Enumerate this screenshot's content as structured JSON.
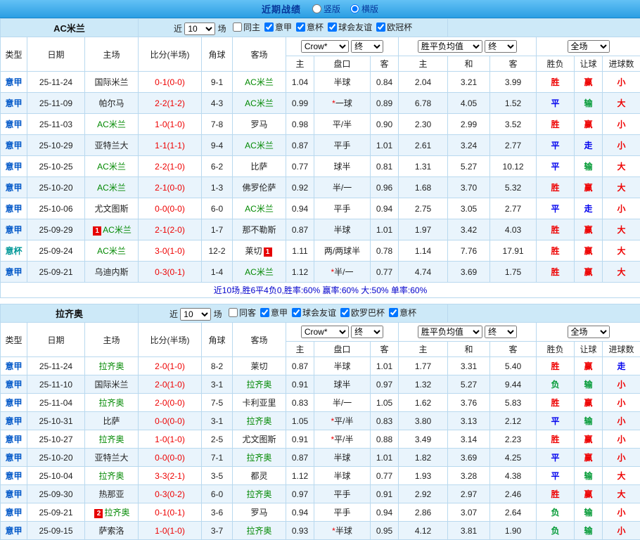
{
  "topbar": {
    "title": "近期战绩",
    "options": [
      {
        "label": "竖版",
        "selected": false
      },
      {
        "label": "横版",
        "selected": true
      }
    ]
  },
  "table_header": {
    "col_type": "类型",
    "col_date": "日期",
    "col_home": "主场",
    "col_score": "比分(半场)",
    "col_corner": "角球",
    "col_away": "客场",
    "col_h": "主",
    "col_handicap": "盘口",
    "col_a": "客",
    "col_ew": "主",
    "col_ed": "和",
    "col_el": "客",
    "col_win": "胜负",
    "col_let": "让球",
    "col_goal": "进球数"
  },
  "colors": {
    "type": {
      "意甲": "#0057c8",
      "意杯": "#009898"
    },
    "outcome": {
      "胜": "#ee0000",
      "平": "#0000ee",
      "负": "#009933",
      "赢": "#ee0000",
      "输": "#009933",
      "走": "#0000ee",
      "大": "#ee0000",
      "小": "#ee0000"
    },
    "team_highlight": "#008800",
    "score": "#ee0000",
    "asterisk": "#ee0000"
  },
  "sections": [
    {
      "team": "AC米兰",
      "near_label": "近",
      "count": "10",
      "matches_label": "场",
      "checkboxes": [
        {
          "label": "同主",
          "checked": false
        },
        {
          "label": "意甲",
          "checked": true
        },
        {
          "label": "意杯",
          "checked": true
        },
        {
          "label": "球会友谊",
          "checked": true
        },
        {
          "label": "欧冠杯",
          "checked": true
        }
      ],
      "dropdowns": [
        "Crow*",
        "终",
        "胜平负均值",
        "终",
        "全场"
      ],
      "rows": [
        {
          "type": "意甲",
          "date": "25-11-24",
          "home": "国际米兰",
          "home_badge": "",
          "score": "0-1(0-0)",
          "corner": "9-1",
          "away": "AC米兰",
          "away_badge": "",
          "odds": [
            "1.04",
            "半球",
            "0.84"
          ],
          "europe": [
            "2.04",
            "3.21",
            "3.99"
          ],
          "result": [
            "胜",
            "赢",
            "小"
          ]
        },
        {
          "type": "意甲",
          "date": "25-11-09",
          "home": "帕尔马",
          "home_badge": "",
          "score": "2-2(1-2)",
          "corner": "4-3",
          "away": "AC米兰",
          "away_badge": "",
          "odds": [
            "0.99",
            "*一球",
            "0.89"
          ],
          "europe": [
            "6.78",
            "4.05",
            "1.52"
          ],
          "result": [
            "平",
            "输",
            "大"
          ]
        },
        {
          "type": "意甲",
          "date": "25-11-03",
          "home": "AC米兰",
          "home_badge": "",
          "score": "1-0(1-0)",
          "corner": "7-8",
          "away": "罗马",
          "away_badge": "",
          "odds": [
            "0.98",
            "平/半",
            "0.90"
          ],
          "europe": [
            "2.30",
            "2.99",
            "3.52"
          ],
          "result": [
            "胜",
            "赢",
            "小"
          ]
        },
        {
          "type": "意甲",
          "date": "25-10-29",
          "home": "亚特兰大",
          "home_badge": "",
          "score": "1-1(1-1)",
          "corner": "9-4",
          "away": "AC米兰",
          "away_badge": "",
          "odds": [
            "0.87",
            "平手",
            "1.01"
          ],
          "europe": [
            "2.61",
            "3.24",
            "2.77"
          ],
          "result": [
            "平",
            "走",
            "小"
          ]
        },
        {
          "type": "意甲",
          "date": "25-10-25",
          "home": "AC米兰",
          "home_badge": "",
          "score": "2-2(1-0)",
          "corner": "6-2",
          "away": "比萨",
          "away_badge": "",
          "odds": [
            "0.77",
            "球半",
            "0.81"
          ],
          "europe": [
            "1.31",
            "5.27",
            "10.12"
          ],
          "result": [
            "平",
            "输",
            "大"
          ]
        },
        {
          "type": "意甲",
          "date": "25-10-20",
          "home": "AC米兰",
          "home_badge": "",
          "score": "2-1(0-0)",
          "corner": "1-3",
          "away": "佛罗伦萨",
          "away_badge": "",
          "odds": [
            "0.92",
            "半/一",
            "0.96"
          ],
          "europe": [
            "1.68",
            "3.70",
            "5.32"
          ],
          "result": [
            "胜",
            "赢",
            "大"
          ]
        },
        {
          "type": "意甲",
          "date": "25-10-06",
          "home": "尤文图斯",
          "home_badge": "",
          "score": "0-0(0-0)",
          "corner": "6-0",
          "away": "AC米兰",
          "away_badge": "",
          "odds": [
            "0.94",
            "平手",
            "0.94"
          ],
          "europe": [
            "2.75",
            "3.05",
            "2.77"
          ],
          "result": [
            "平",
            "走",
            "小"
          ]
        },
        {
          "type": "意甲",
          "date": "25-09-29",
          "home": "AC米兰",
          "home_badge": "1",
          "score": "2-1(2-0)",
          "corner": "1-7",
          "away": "那不勒斯",
          "away_badge": "",
          "odds": [
            "0.87",
            "半球",
            "1.01"
          ],
          "europe": [
            "1.97",
            "3.42",
            "4.03"
          ],
          "result": [
            "胜",
            "赢",
            "大"
          ]
        },
        {
          "type": "意杯",
          "date": "25-09-24",
          "home": "AC米兰",
          "home_badge": "",
          "score": "3-0(1-0)",
          "corner": "12-2",
          "away": "莱切",
          "away_badge": "1",
          "odds": [
            "1.11",
            "两/两球半",
            "0.78"
          ],
          "europe": [
            "1.14",
            "7.76",
            "17.91"
          ],
          "result": [
            "胜",
            "赢",
            "大"
          ]
        },
        {
          "type": "意甲",
          "date": "25-09-21",
          "home": "乌迪内斯",
          "home_badge": "",
          "score": "0-3(0-1)",
          "corner": "1-4",
          "away": "AC米兰",
          "away_badge": "",
          "odds": [
            "1.12",
            "*半/一",
            "0.77"
          ],
          "europe": [
            "4.74",
            "3.69",
            "1.75"
          ],
          "result": [
            "胜",
            "赢",
            "大"
          ]
        }
      ],
      "summary": "近10场,胜6平4负0,胜率:60% 赢率:60% 大:50% 单率:60%"
    },
    {
      "team": "拉齐奥",
      "near_label": "近",
      "count": "10",
      "matches_label": "场",
      "checkboxes": [
        {
          "label": "同客",
          "checked": false
        },
        {
          "label": "意甲",
          "checked": true
        },
        {
          "label": "球会友谊",
          "checked": true
        },
        {
          "label": "欧罗巴杯",
          "checked": true
        },
        {
          "label": "意杯",
          "checked": true
        }
      ],
      "dropdowns": [
        "Crow*",
        "终",
        "胜平负均值",
        "终",
        "全场"
      ],
      "rows": [
        {
          "type": "意甲",
          "date": "25-11-24",
          "home": "拉齐奥",
          "home_badge": "",
          "score": "2-0(1-0)",
          "corner": "8-2",
          "away": "莱切",
          "away_badge": "",
          "odds": [
            "0.87",
            "半球",
            "1.01"
          ],
          "europe": [
            "1.77",
            "3.31",
            "5.40"
          ],
          "result": [
            "胜",
            "赢",
            "走"
          ]
        },
        {
          "type": "意甲",
          "date": "25-11-10",
          "home": "国际米兰",
          "home_badge": "",
          "score": "2-0(1-0)",
          "corner": "3-1",
          "away": "拉齐奥",
          "away_badge": "",
          "odds": [
            "0.91",
            "球半",
            "0.97"
          ],
          "europe": [
            "1.32",
            "5.27",
            "9.44"
          ],
          "result": [
            "负",
            "输",
            "小"
          ]
        },
        {
          "type": "意甲",
          "date": "25-11-04",
          "home": "拉齐奥",
          "home_badge": "",
          "score": "2-0(0-0)",
          "corner": "7-5",
          "away": "卡利亚里",
          "away_badge": "",
          "odds": [
            "0.83",
            "半/一",
            "1.05"
          ],
          "europe": [
            "1.62",
            "3.76",
            "5.83"
          ],
          "result": [
            "胜",
            "赢",
            "小"
          ]
        },
        {
          "type": "意甲",
          "date": "25-10-31",
          "home": "比萨",
          "home_badge": "",
          "score": "0-0(0-0)",
          "corner": "3-1",
          "away": "拉齐奥",
          "away_badge": "",
          "odds": [
            "1.05",
            "*平/半",
            "0.83"
          ],
          "europe": [
            "3.80",
            "3.13",
            "2.12"
          ],
          "result": [
            "平",
            "输",
            "小"
          ]
        },
        {
          "type": "意甲",
          "date": "25-10-27",
          "home": "拉齐奥",
          "home_badge": "",
          "score": "1-0(1-0)",
          "corner": "2-5",
          "away": "尤文图斯",
          "away_badge": "",
          "odds": [
            "0.91",
            "*平/半",
            "0.88"
          ],
          "europe": [
            "3.49",
            "3.14",
            "2.23"
          ],
          "result": [
            "胜",
            "赢",
            "小"
          ]
        },
        {
          "type": "意甲",
          "date": "25-10-20",
          "home": "亚特兰大",
          "home_badge": "",
          "score": "0-0(0-0)",
          "corner": "7-1",
          "away": "拉齐奥",
          "away_badge": "",
          "odds": [
            "0.87",
            "半球",
            "1.01"
          ],
          "europe": [
            "1.82",
            "3.69",
            "4.25"
          ],
          "result": [
            "平",
            "赢",
            "小"
          ]
        },
        {
          "type": "意甲",
          "date": "25-10-04",
          "home": "拉齐奥",
          "home_badge": "",
          "score": "3-3(2-1)",
          "corner": "3-5",
          "away": "都灵",
          "away_badge": "",
          "odds": [
            "1.12",
            "半球",
            "0.77"
          ],
          "europe": [
            "1.93",
            "3.28",
            "4.38"
          ],
          "result": [
            "平",
            "输",
            "大"
          ]
        },
        {
          "type": "意甲",
          "date": "25-09-30",
          "home": "热那亚",
          "home_badge": "",
          "score": "0-3(0-2)",
          "corner": "6-0",
          "away": "拉齐奥",
          "away_badge": "",
          "odds": [
            "0.97",
            "平手",
            "0.91"
          ],
          "europe": [
            "2.92",
            "2.97",
            "2.46"
          ],
          "result": [
            "胜",
            "赢",
            "大"
          ]
        },
        {
          "type": "意甲",
          "date": "25-09-21",
          "home": "拉齐奥",
          "home_badge": "2",
          "score": "0-1(0-1)",
          "corner": "3-6",
          "away": "罗马",
          "away_badge": "",
          "odds": [
            "0.94",
            "平手",
            "0.94"
          ],
          "europe": [
            "2.86",
            "3.07",
            "2.64"
          ],
          "result": [
            "负",
            "输",
            "小"
          ]
        },
        {
          "type": "意甲",
          "date": "25-09-15",
          "home": "萨索洛",
          "home_badge": "",
          "score": "1-0(1-0)",
          "corner": "3-7",
          "away": "拉齐奥",
          "away_badge": "",
          "odds": [
            "0.93",
            "*半球",
            "0.95"
          ],
          "europe": [
            "4.12",
            "3.81",
            "1.90"
          ],
          "result": [
            "负",
            "输",
            "小"
          ]
        }
      ]
    }
  ]
}
